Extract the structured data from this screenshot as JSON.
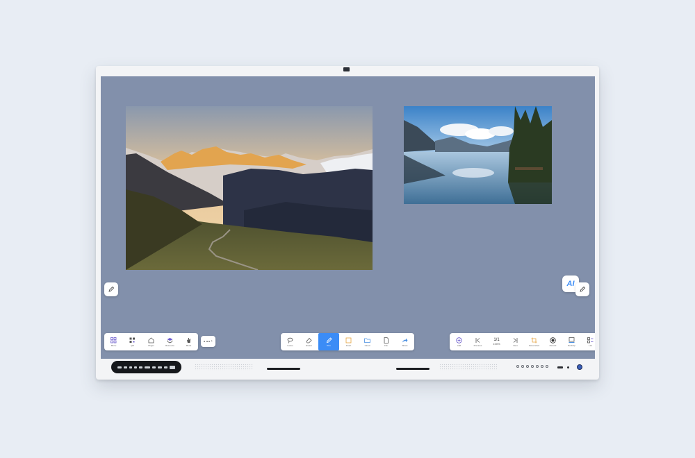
{
  "left_toolbar": {
    "items": [
      {
        "label": "Menu",
        "icon": "grid-icon"
      },
      {
        "label": "QR",
        "icon": "qr-code-icon"
      },
      {
        "label": "Plugin",
        "icon": "plugin-icon"
      },
      {
        "label": "Resource",
        "icon": "resource-icon"
      },
      {
        "label": "Mode",
        "icon": "hand-icon"
      }
    ]
  },
  "more_button": {
    "icon": "more-icon"
  },
  "center_toolbar": {
    "active_item": "Pen",
    "items": [
      {
        "label": "Lasso",
        "icon": "lasso-icon"
      },
      {
        "label": "Eraser",
        "icon": "eraser-icon"
      },
      {
        "label": "Pen",
        "icon": "pen-icon"
      },
      {
        "label": "Insert",
        "icon": "insert-icon"
      },
      {
        "label": "Cloud",
        "icon": "folder-icon"
      },
      {
        "label": "File",
        "icon": "file-icon"
      },
      {
        "label": "Share",
        "icon": "share-icon"
      }
    ]
  },
  "right_toolbar": {
    "items": [
      {
        "label": "Add",
        "icon": "add-page-icon"
      },
      {
        "label": "Previous",
        "icon": "previous-page-icon"
      },
      {
        "label": "Next",
        "icon": "next-page-icon"
      },
      {
        "label": "Screenshot",
        "icon": "crop-icon"
      },
      {
        "label": "Record",
        "icon": "record-icon"
      },
      {
        "label": "Desktop",
        "icon": "desktop-icon"
      },
      {
        "label": "List",
        "icon": "list-icon"
      }
    ],
    "page": "1/1",
    "zoom": "100%"
  },
  "ai_assistant": {
    "text": "AI",
    "accent": "#3b8cf6"
  },
  "colors": {
    "canvas_background": "#8290ab",
    "active_tool": "#3b8cf6",
    "power_button": "#3b5fb8"
  }
}
